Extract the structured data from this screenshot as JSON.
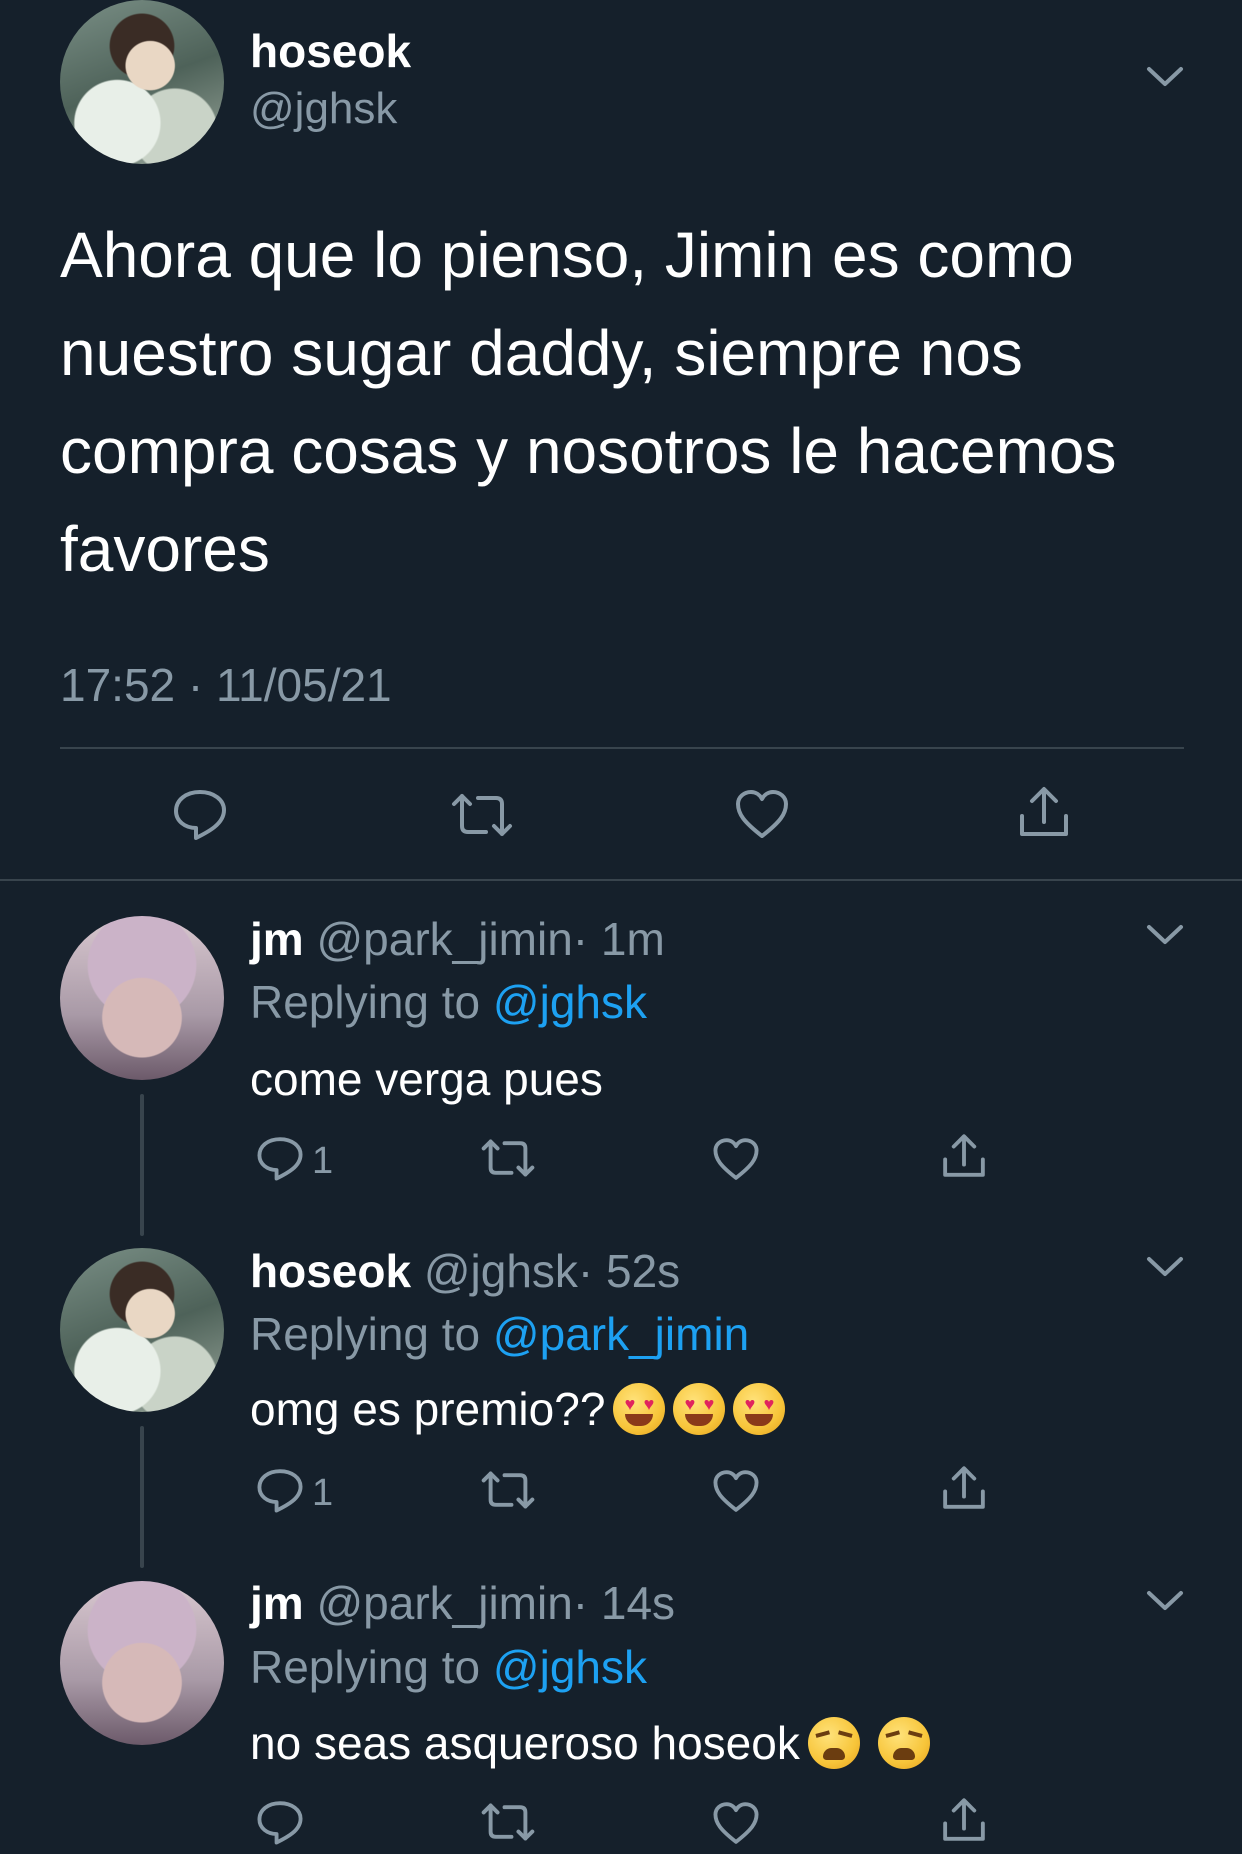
{
  "main_tweet": {
    "name": "hoseok",
    "handle": "@jghsk",
    "text": "Ahora que lo pienso, Jimin es como nuestro sugar daddy, siempre nos compra cosas y nosotros le hacemos favores",
    "timestamp": "17:52 · 11/05/21"
  },
  "replies": [
    {
      "name": "jm",
      "handle": "@park_jimin",
      "time": "· 1m",
      "replying_prefix": "Replying to",
      "replying_to": "@jghsk",
      "text": "come verga pues",
      "reply_count": "1"
    },
    {
      "name": "hoseok",
      "handle": "@jghsk",
      "time": "· 52s",
      "replying_prefix": "Replying to",
      "replying_to": "@park_jimin",
      "text": "omg es premio??",
      "reply_count": "1"
    },
    {
      "name": "jm",
      "handle": "@park_jimin",
      "time": "· 14s",
      "replying_prefix": "Replying to",
      "replying_to": "@jghsk",
      "text": "no seas asqueroso hoseok",
      "reply_count": ""
    }
  ],
  "colors": {
    "background": "#15202b",
    "muted": "#8899a6",
    "link": "#1da1f2",
    "divider": "#38444d"
  }
}
